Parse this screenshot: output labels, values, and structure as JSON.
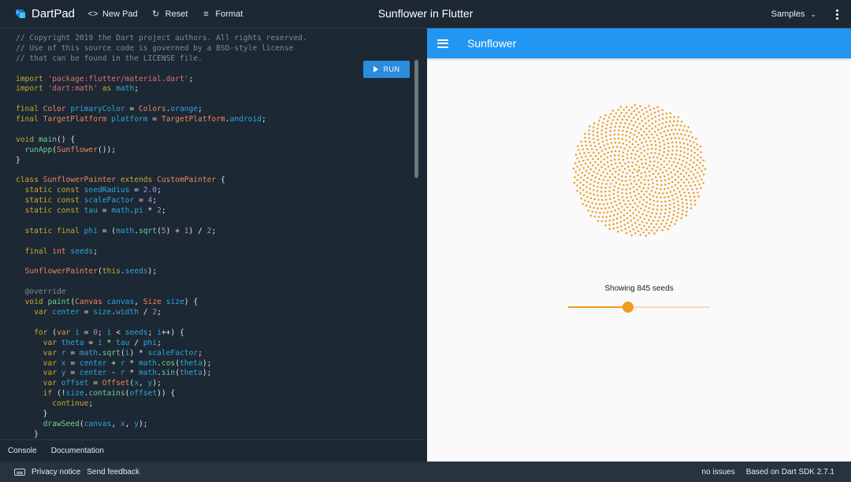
{
  "header": {
    "brand": "DartPad",
    "new_pad": "New Pad",
    "reset": "Reset",
    "format": "Format",
    "title": "Sunflower in Flutter",
    "samples": "Samples"
  },
  "editor": {
    "run_label": "RUN",
    "lines": [
      [
        [
          "c",
          "// Copyright 2019 the Dart project authors. All rights reserved."
        ]
      ],
      [
        [
          "c",
          "// Use of this source code is governed by a BSD-style license"
        ]
      ],
      [
        [
          "c",
          "// that can be found in the LICENSE file."
        ]
      ],
      [],
      [
        [
          "k",
          "import "
        ],
        [
          "s",
          "'package:flutter/material.dart'"
        ],
        [
          "p",
          ";"
        ]
      ],
      [
        [
          "k",
          "import "
        ],
        [
          "s",
          "'dart:math'"
        ],
        [
          "k",
          " as "
        ],
        [
          "v",
          "math"
        ],
        [
          "p",
          ";"
        ]
      ],
      [],
      [
        [
          "k",
          "final "
        ],
        [
          "t",
          "Color "
        ],
        [
          "v",
          "primaryColor"
        ],
        [
          "p",
          " = "
        ],
        [
          "t",
          "Colors"
        ],
        [
          "p",
          "."
        ],
        [
          "v",
          "orange"
        ],
        [
          "p",
          ";"
        ]
      ],
      [
        [
          "k",
          "final "
        ],
        [
          "t",
          "TargetPlatform "
        ],
        [
          "v",
          "platform"
        ],
        [
          "p",
          " = "
        ],
        [
          "t",
          "TargetPlatform"
        ],
        [
          "p",
          "."
        ],
        [
          "v",
          "android"
        ],
        [
          "p",
          ";"
        ]
      ],
      [],
      [
        [
          "k",
          "void "
        ],
        [
          "f",
          "main"
        ],
        [
          "p",
          "() {"
        ]
      ],
      [
        [
          "p",
          "  "
        ],
        [
          "f",
          "runApp"
        ],
        [
          "p",
          "("
        ],
        [
          "t",
          "Sunflower"
        ],
        [
          "p",
          "());"
        ]
      ],
      [
        [
          "p",
          "}"
        ]
      ],
      [],
      [
        [
          "k",
          "class "
        ],
        [
          "t",
          "SunflowerPainter "
        ],
        [
          "k",
          "extends "
        ],
        [
          "t",
          "CustomPainter "
        ],
        [
          "p",
          "{"
        ]
      ],
      [
        [
          "p",
          "  "
        ],
        [
          "k",
          "static const "
        ],
        [
          "v",
          "seedRadius"
        ],
        [
          "p",
          " = "
        ],
        [
          "n",
          "2.0"
        ],
        [
          "p",
          ";"
        ]
      ],
      [
        [
          "p",
          "  "
        ],
        [
          "k",
          "static const "
        ],
        [
          "v",
          "scaleFactor"
        ],
        [
          "p",
          " = "
        ],
        [
          "n",
          "4"
        ],
        [
          "p",
          ";"
        ]
      ],
      [
        [
          "p",
          "  "
        ],
        [
          "k",
          "static const "
        ],
        [
          "v",
          "tau"
        ],
        [
          "p",
          " = "
        ],
        [
          "v",
          "math"
        ],
        [
          "p",
          "."
        ],
        [
          "v",
          "pi"
        ],
        [
          "p",
          " * "
        ],
        [
          "n",
          "2"
        ],
        [
          "p",
          ";"
        ]
      ],
      [],
      [
        [
          "p",
          "  "
        ],
        [
          "k",
          "static final "
        ],
        [
          "v",
          "phi"
        ],
        [
          "p",
          " = ("
        ],
        [
          "v",
          "math"
        ],
        [
          "p",
          "."
        ],
        [
          "f",
          "sqrt"
        ],
        [
          "p",
          "("
        ],
        [
          "n",
          "5"
        ],
        [
          "p",
          ") + "
        ],
        [
          "n",
          "1"
        ],
        [
          "p",
          ") / "
        ],
        [
          "n",
          "2"
        ],
        [
          "p",
          ";"
        ]
      ],
      [],
      [
        [
          "p",
          "  "
        ],
        [
          "k",
          "final "
        ],
        [
          "t",
          "int "
        ],
        [
          "v",
          "seeds"
        ],
        [
          "p",
          ";"
        ]
      ],
      [],
      [
        [
          "p",
          "  "
        ],
        [
          "t",
          "SunflowerPainter"
        ],
        [
          "p",
          "("
        ],
        [
          "k",
          "this"
        ],
        [
          "p",
          "."
        ],
        [
          "v",
          "seeds"
        ],
        [
          "p",
          ");"
        ]
      ],
      [],
      [
        [
          "p",
          "  "
        ],
        [
          "c",
          "@override"
        ]
      ],
      [
        [
          "p",
          "  "
        ],
        [
          "k",
          "void "
        ],
        [
          "f",
          "paint"
        ],
        [
          "p",
          "("
        ],
        [
          "t",
          "Canvas "
        ],
        [
          "v",
          "canvas"
        ],
        [
          "p",
          ", "
        ],
        [
          "t",
          "Size "
        ],
        [
          "v",
          "size"
        ],
        [
          "p",
          ") {"
        ]
      ],
      [
        [
          "p",
          "    "
        ],
        [
          "k",
          "var "
        ],
        [
          "v",
          "center"
        ],
        [
          "p",
          " = "
        ],
        [
          "v",
          "size"
        ],
        [
          "p",
          "."
        ],
        [
          "v",
          "width"
        ],
        [
          "p",
          " / "
        ],
        [
          "n",
          "2"
        ],
        [
          "p",
          ";"
        ]
      ],
      [],
      [
        [
          "p",
          "    "
        ],
        [
          "k",
          "for "
        ],
        [
          "p",
          "("
        ],
        [
          "k",
          "var "
        ],
        [
          "v",
          "i"
        ],
        [
          "p",
          " = "
        ],
        [
          "n",
          "0"
        ],
        [
          "p",
          "; "
        ],
        [
          "v",
          "i"
        ],
        [
          "p",
          " < "
        ],
        [
          "v",
          "seeds"
        ],
        [
          "p",
          "; "
        ],
        [
          "v",
          "i"
        ],
        [
          "p",
          "++) {"
        ]
      ],
      [
        [
          "p",
          "      "
        ],
        [
          "k",
          "var "
        ],
        [
          "v",
          "theta"
        ],
        [
          "p",
          " = "
        ],
        [
          "v",
          "i"
        ],
        [
          "p",
          " * "
        ],
        [
          "v",
          "tau"
        ],
        [
          "p",
          " / "
        ],
        [
          "v",
          "phi"
        ],
        [
          "p",
          ";"
        ]
      ],
      [
        [
          "p",
          "      "
        ],
        [
          "k",
          "var "
        ],
        [
          "v",
          "r"
        ],
        [
          "p",
          " = "
        ],
        [
          "v",
          "math"
        ],
        [
          "p",
          "."
        ],
        [
          "f",
          "sqrt"
        ],
        [
          "p",
          "("
        ],
        [
          "v",
          "i"
        ],
        [
          "p",
          ") * "
        ],
        [
          "v",
          "scaleFactor"
        ],
        [
          "p",
          ";"
        ]
      ],
      [
        [
          "p",
          "      "
        ],
        [
          "k",
          "var "
        ],
        [
          "v",
          "x"
        ],
        [
          "p",
          " = "
        ],
        [
          "v",
          "center"
        ],
        [
          "p",
          " + "
        ],
        [
          "v",
          "r"
        ],
        [
          "p",
          " * "
        ],
        [
          "v",
          "math"
        ],
        [
          "p",
          "."
        ],
        [
          "f",
          "cos"
        ],
        [
          "p",
          "("
        ],
        [
          "v",
          "theta"
        ],
        [
          "p",
          ");"
        ]
      ],
      [
        [
          "p",
          "      "
        ],
        [
          "k",
          "var "
        ],
        [
          "v",
          "y"
        ],
        [
          "p",
          " = "
        ],
        [
          "v",
          "center"
        ],
        [
          "p",
          " - "
        ],
        [
          "v",
          "r"
        ],
        [
          "p",
          " * "
        ],
        [
          "v",
          "math"
        ],
        [
          "p",
          "."
        ],
        [
          "f",
          "sin"
        ],
        [
          "p",
          "("
        ],
        [
          "v",
          "theta"
        ],
        [
          "p",
          ");"
        ]
      ],
      [
        [
          "p",
          "      "
        ],
        [
          "k",
          "var "
        ],
        [
          "v",
          "offset"
        ],
        [
          "p",
          " = "
        ],
        [
          "t",
          "Offset"
        ],
        [
          "p",
          "("
        ],
        [
          "v",
          "x"
        ],
        [
          "p",
          ", "
        ],
        [
          "v",
          "y"
        ],
        [
          "p",
          ");"
        ]
      ],
      [
        [
          "p",
          "      "
        ],
        [
          "k",
          "if "
        ],
        [
          "p",
          "(!"
        ],
        [
          "v",
          "size"
        ],
        [
          "p",
          "."
        ],
        [
          "f",
          "contains"
        ],
        [
          "p",
          "("
        ],
        [
          "v",
          "offset"
        ],
        [
          "p",
          ")) {"
        ]
      ],
      [
        [
          "p",
          "        "
        ],
        [
          "k",
          "continue"
        ],
        [
          "p",
          ";"
        ]
      ],
      [
        [
          "p",
          "      }"
        ]
      ],
      [
        [
          "p",
          "      "
        ],
        [
          "f",
          "drawSeed"
        ],
        [
          "p",
          "("
        ],
        [
          "v",
          "canvas"
        ],
        [
          "p",
          ", "
        ],
        [
          "v",
          "x"
        ],
        [
          "p",
          ", "
        ],
        [
          "v",
          "y"
        ],
        [
          "p",
          ");"
        ]
      ],
      [
        [
          "p",
          "    }"
        ]
      ]
    ]
  },
  "bottom": {
    "console": "Console",
    "documentation": "Documentation"
  },
  "footer": {
    "privacy": "Privacy notice",
    "feedback": "Send feedback",
    "issues": "no issues",
    "sdk": "Based on Dart SDK 2.7.1"
  },
  "preview": {
    "appbar_title": "Sunflower",
    "seeds_label": "Showing 845 seeds",
    "seed_count": 845,
    "slider_fraction": 0.42,
    "seed_color": "#f29a1c",
    "accent": "#2196f3"
  }
}
